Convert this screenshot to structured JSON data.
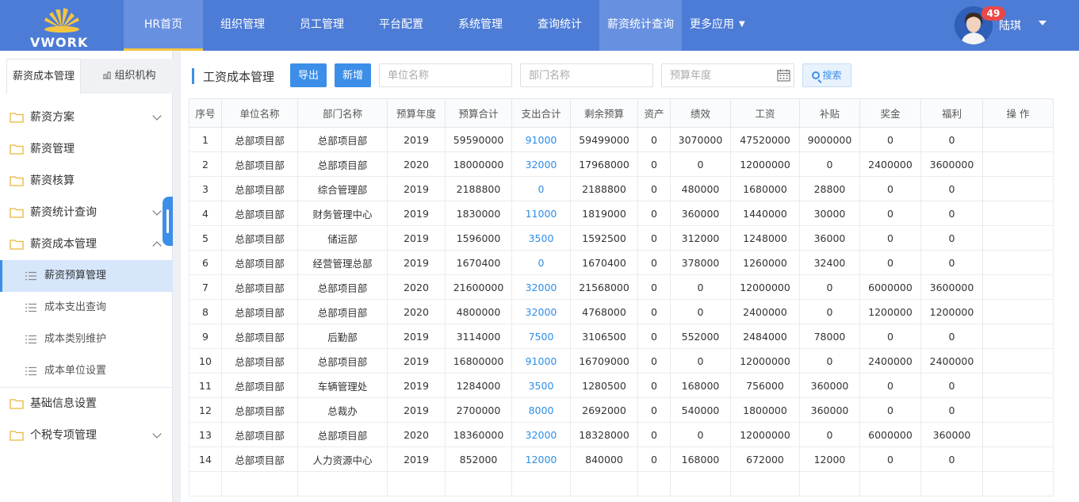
{
  "header": {
    "logo_text": "VWORK",
    "nav": [
      {
        "label": "HR首页"
      },
      {
        "label": "组织管理"
      },
      {
        "label": "员工管理"
      },
      {
        "label": "平台配置"
      },
      {
        "label": "系统管理"
      },
      {
        "label": "查询统计"
      },
      {
        "label": "薪资统计查询"
      },
      {
        "label": "更多应用"
      }
    ],
    "user": {
      "name": "陆琪",
      "badge": "49"
    }
  },
  "sidebar": {
    "tabs": [
      {
        "label": "薪资成本管理",
        "active": true
      },
      {
        "label": "组织机构",
        "active": false
      }
    ],
    "menu": [
      {
        "label": "薪资方案",
        "expandable": true
      },
      {
        "label": "薪资管理",
        "expandable": false
      },
      {
        "label": "薪资核算",
        "expandable": false
      },
      {
        "label": "薪资统计查询",
        "expandable": true
      },
      {
        "label": "薪资成本管理",
        "expandable": true,
        "open": true
      },
      {
        "label": "基础信息设置",
        "expandable": false
      },
      {
        "label": "个税专项管理",
        "expandable": true
      }
    ],
    "submenu": [
      {
        "label": "薪资预算管理",
        "active": true
      },
      {
        "label": "成本支出查询"
      },
      {
        "label": "成本类别维护"
      },
      {
        "label": "成本单位设置"
      }
    ]
  },
  "toolbar": {
    "title": "工资成本管理",
    "export_label": "导出",
    "add_label": "新增",
    "unit_placeholder": "单位名称",
    "dept_placeholder": "部门名称",
    "year_placeholder": "预算年度",
    "search_label": "搜索"
  },
  "table": {
    "columns": [
      "序号",
      "单位名称",
      "部门名称",
      "预算年度",
      "预算合计",
      "支出合计",
      "剩余预算",
      "资产",
      "绩效",
      "工资",
      "补贴",
      "奖金",
      "福利",
      "操 作"
    ],
    "rows": [
      [
        "1",
        "总部项目部",
        "总部项目部",
        "2019",
        "59590000",
        "91000",
        "59499000",
        "0",
        "3070000",
        "47520000",
        "9000000",
        "0",
        "0",
        ""
      ],
      [
        "2",
        "总部项目部",
        "总部项目部",
        "2020",
        "18000000",
        "32000",
        "17968000",
        "0",
        "0",
        "12000000",
        "0",
        "2400000",
        "3600000",
        ""
      ],
      [
        "3",
        "总部项目部",
        "综合管理部",
        "2019",
        "2188800",
        "0",
        "2188800",
        "0",
        "480000",
        "1680000",
        "28800",
        "0",
        "0",
        ""
      ],
      [
        "4",
        "总部项目部",
        "财务管理中心",
        "2019",
        "1830000",
        "11000",
        "1819000",
        "0",
        "360000",
        "1440000",
        "30000",
        "0",
        "0",
        ""
      ],
      [
        "5",
        "总部项目部",
        "储运部",
        "2019",
        "1596000",
        "3500",
        "1592500",
        "0",
        "312000",
        "1248000",
        "36000",
        "0",
        "0",
        ""
      ],
      [
        "6",
        "总部项目部",
        "经营管理总部",
        "2019",
        "1670400",
        "0",
        "1670400",
        "0",
        "378000",
        "1260000",
        "32400",
        "0",
        "0",
        ""
      ],
      [
        "7",
        "总部项目部",
        "总部项目部",
        "2020",
        "21600000",
        "32000",
        "21568000",
        "0",
        "0",
        "12000000",
        "0",
        "6000000",
        "3600000",
        ""
      ],
      [
        "8",
        "总部项目部",
        "总部项目部",
        "2020",
        "4800000",
        "32000",
        "4768000",
        "0",
        "0",
        "2400000",
        "0",
        "1200000",
        "1200000",
        ""
      ],
      [
        "9",
        "总部项目部",
        "后勤部",
        "2019",
        "3114000",
        "7500",
        "3106500",
        "0",
        "552000",
        "2484000",
        "78000",
        "0",
        "0",
        ""
      ],
      [
        "10",
        "总部项目部",
        "总部项目部",
        "2019",
        "16800000",
        "91000",
        "16709000",
        "0",
        "0",
        "12000000",
        "0",
        "2400000",
        "2400000",
        ""
      ],
      [
        "11",
        "总部项目部",
        "车辆管理处",
        "2019",
        "1284000",
        "3500",
        "1280500",
        "0",
        "168000",
        "756000",
        "360000",
        "0",
        "0",
        ""
      ],
      [
        "12",
        "总部项目部",
        "总裁办",
        "2019",
        "2700000",
        "8000",
        "2692000",
        "0",
        "540000",
        "1800000",
        "360000",
        "0",
        "0",
        ""
      ],
      [
        "13",
        "总部项目部",
        "总部项目部",
        "2020",
        "18360000",
        "32000",
        "18328000",
        "0",
        "0",
        "12000000",
        "0",
        "6000000",
        "360000",
        ""
      ],
      [
        "14",
        "总部项目部",
        "人力资源中心",
        "2019",
        "852000",
        "12000",
        "840000",
        "0",
        "168000",
        "672000",
        "12000",
        "0",
        "0",
        ""
      ]
    ]
  },
  "colors": {
    "header_bg": "#4d7cd6",
    "accent": "#3d8ee8",
    "link": "#2e8ee6",
    "active_nav_bg": "#6790e0"
  }
}
